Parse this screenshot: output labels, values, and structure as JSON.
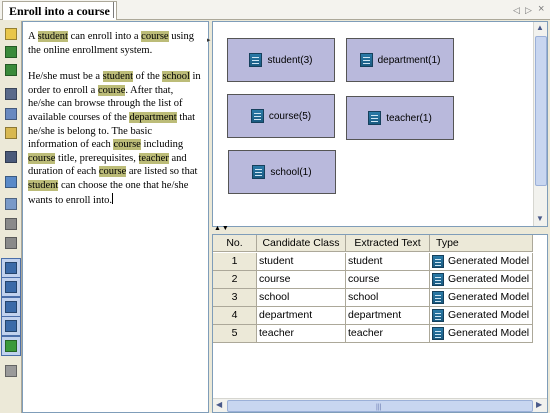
{
  "tab": {
    "title": "Enroll into a course"
  },
  "tabnav": {
    "prev": "◁",
    "next": "▷",
    "close": "×"
  },
  "toolbar": {
    "tools": [
      {
        "icon": "open-folder-icon",
        "color": "#e8c64a"
      },
      {
        "icon": "save-icon",
        "color": "#3a8a3a"
      },
      {
        "icon": "save-all-icon",
        "color": "#3a8a3a"
      },
      {
        "icon": "cut-icon",
        "color": "#5a6a8a"
      },
      {
        "icon": "copy-icon",
        "color": "#6a8ac0"
      },
      {
        "icon": "paste-icon",
        "color": "#d8b850"
      },
      {
        "icon": "find-icon",
        "color": "#4a5a7a"
      },
      {
        "icon": "text-box-icon",
        "color": "#5a8ac8"
      },
      {
        "icon": "document-icon",
        "color": "#7a9ac8"
      },
      {
        "icon": "list-icon",
        "color": "#8a8a8a"
      },
      {
        "icon": "table-icon",
        "color": "#8a8a8a"
      },
      {
        "icon": "class-icon",
        "color": "#3a6aa8"
      },
      {
        "icon": "actor-icon",
        "color": "#3a6aa8"
      },
      {
        "icon": "usecase-icon",
        "color": "#3a6aa8"
      },
      {
        "icon": "association-icon",
        "color": "#3a6aa8"
      },
      {
        "icon": "help-icon",
        "color": "#3a9a3a"
      },
      {
        "icon": "font-icon",
        "color": "#9a9a9a"
      }
    ]
  },
  "text": {
    "p1": [
      {
        "t": "A "
      },
      {
        "t": "student",
        "h": true
      },
      {
        "t": " can enroll into a "
      },
      {
        "t": "course",
        "h": true
      },
      {
        "t": " using the online enrollment system."
      }
    ],
    "p2": [
      {
        "t": "He/she must be a "
      },
      {
        "t": "student",
        "h": true
      },
      {
        "t": " of the "
      },
      {
        "t": "school",
        "h": true
      },
      {
        "t": " in order to enroll a "
      },
      {
        "t": "course",
        "h": true
      },
      {
        "t": ". After that, he/she can browse through the list of available courses of the "
      },
      {
        "t": "department",
        "h": true
      },
      {
        "t": " that he/she is belong to. The basic information of each "
      },
      {
        "t": "course",
        "h": true
      },
      {
        "t": " including "
      },
      {
        "t": "course",
        "h": true
      },
      {
        "t": " title, prerequisites, "
      },
      {
        "t": "teacher",
        "h": true
      },
      {
        "t": " and duration of each "
      },
      {
        "t": "course",
        "h": true
      },
      {
        "t": " are listed so that "
      },
      {
        "t": "student",
        "h": true
      },
      {
        "t": " can choose the one that he/she wants to enroll into."
      }
    ]
  },
  "diagram": {
    "nodes": [
      {
        "label": "student(3)",
        "icon": "class-icon"
      },
      {
        "label": "department(1)",
        "icon": "class-icon"
      },
      {
        "label": "course(5)",
        "icon": "class-icon"
      },
      {
        "label": "teacher(1)",
        "icon": "class-icon"
      },
      {
        "label": "school(1)",
        "icon": "class-icon"
      }
    ]
  },
  "table": {
    "headers": [
      "No.",
      "Candidate Class",
      "Extracted Text",
      "Type"
    ],
    "rows": [
      {
        "no": "1",
        "candidate": "student",
        "extracted": "student",
        "type": "Generated Model"
      },
      {
        "no": "2",
        "candidate": "course",
        "extracted": "course",
        "type": "Generated Model"
      },
      {
        "no": "3",
        "candidate": "school",
        "extracted": "school",
        "type": "Generated Model"
      },
      {
        "no": "4",
        "candidate": "department",
        "extracted": "department",
        "type": "Generated Model"
      },
      {
        "no": "5",
        "candidate": "teacher",
        "extracted": "teacher",
        "type": "Generated Model"
      }
    ]
  }
}
